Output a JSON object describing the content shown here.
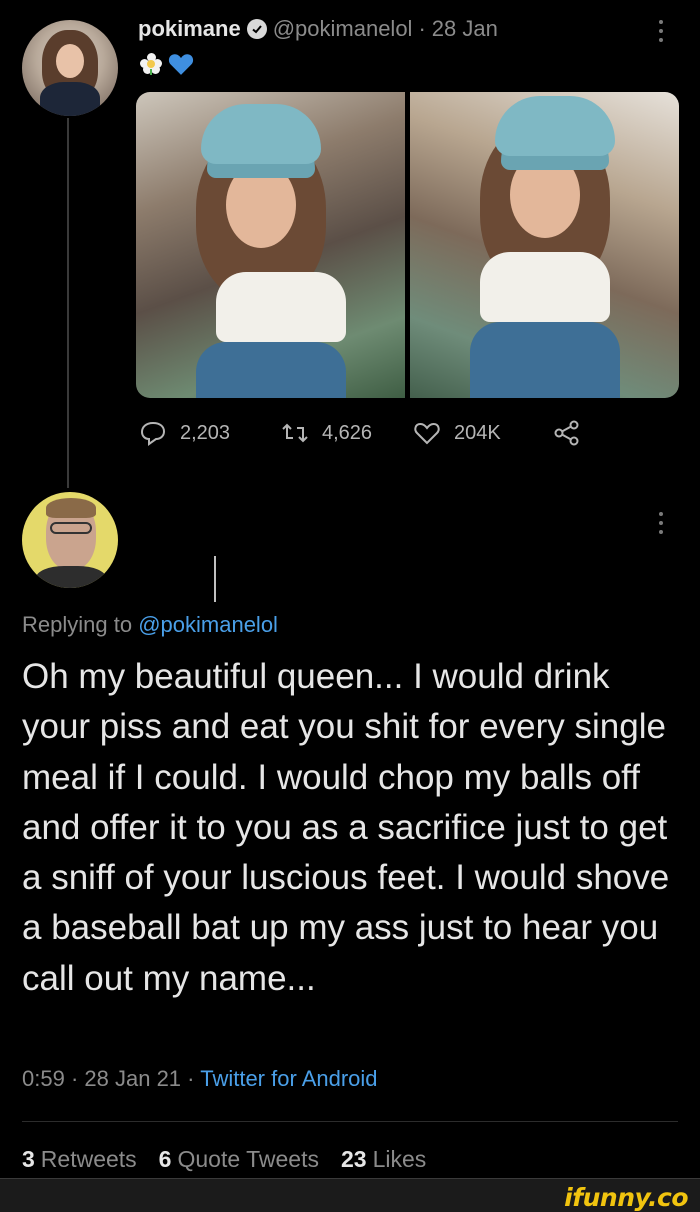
{
  "tweet": {
    "display_name": "pokimane",
    "handle": "@pokimanelol",
    "separator": "·",
    "date": "28 Jan",
    "emojis": [
      "flower-icon",
      "blue-heart-icon"
    ],
    "actions": {
      "replies": "2,203",
      "retweets": "4,626",
      "likes": "204K"
    }
  },
  "reply": {
    "replying_to_prefix": "Replying to",
    "replying_to_handle": "@pokimanelol",
    "text": "Oh my beautiful queen... I would drink your piss and eat you shit for every single meal if I could. I would chop my balls off and offer it to you as a sacrifice just to get a sniff of your luscious feet. I would shove a baseball bat up my ass just to hear you call out my name...",
    "time": "0:59",
    "separator": "·",
    "date": "28 Jan 21",
    "source": "Twitter for Android",
    "stats": {
      "retweets_count": "3",
      "retweets_label": "Retweets",
      "quotes_count": "6",
      "quotes_label": "Quote Tweets",
      "likes_count": "23",
      "likes_label": "Likes"
    }
  },
  "watermark": "ifunny.co",
  "colors": {
    "background": "#000000",
    "link": "#4a9fe8",
    "muted": "#8b8b8b",
    "watermark": "#f1c40f"
  }
}
